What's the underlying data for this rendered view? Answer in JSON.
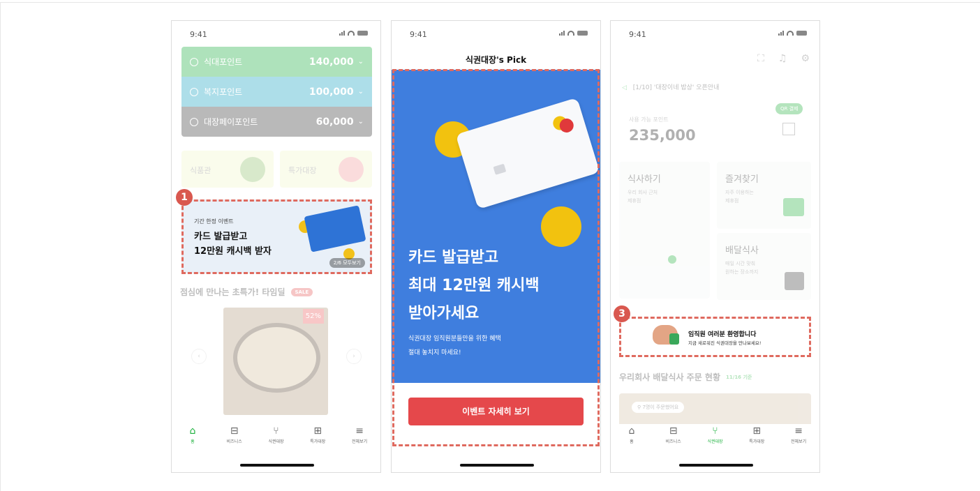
{
  "status": {
    "time": "9:41"
  },
  "phone1": {
    "points": [
      {
        "label": "식대포인트",
        "amount": "140,000",
        "color": "#2db44e"
      },
      {
        "label": "복지포인트",
        "amount": "100,000",
        "color": "#2aa9c6"
      },
      {
        "label": "대장페이포인트",
        "amount": "60,000",
        "color": "#4a4a4a"
      }
    ],
    "shops": [
      "식품관",
      "특가대장"
    ],
    "banner": {
      "small": "기간 한정 이벤트",
      "line1": "카드 발급받고",
      "line2": "12만원 캐시백 받자",
      "pager": "2/6 모두보기"
    },
    "section_title": "점심에 만나는 초특가! 타임딜",
    "sale_badge": "SALE",
    "discount": "52%",
    "tabs": [
      {
        "label": "홈",
        "icon": "home-icon",
        "glyph": "⌂"
      },
      {
        "label": "비즈니스",
        "icon": "briefcase-icon",
        "glyph": "⊟"
      },
      {
        "label": "식권대장",
        "icon": "fork-knife-icon",
        "glyph": "⑂"
      },
      {
        "label": "특가대장",
        "icon": "store-icon",
        "glyph": "⊞"
      },
      {
        "label": "전체보기",
        "icon": "menu-icon",
        "glyph": "≡"
      }
    ],
    "marker": "1"
  },
  "phone2": {
    "header": "식권대장's Pick",
    "title_line1": "카드 발급받고",
    "title_line2": "최대 12만원 캐시백",
    "title_line3": "받아가세요",
    "sub_line1": "식권대장 임직원분들만을 위한 혜택",
    "sub_line2": "절대 놓치지 마세요!",
    "button": "이벤트 자세히 보기"
  },
  "phone3": {
    "notice": "[1/10] '대장이네 밥상' 오픈안내",
    "points_label": "사용 가능 포인트",
    "points_value": "235,000",
    "pill": "QR 결제",
    "tiles": [
      {
        "title": "식사하기",
        "sub1": "우리 회사 근처",
        "sub2": "제휴점"
      },
      {
        "title": "즐겨찾기",
        "sub1": "자주 이용하는",
        "sub2": "제휴점"
      },
      {
        "title": "배달식사",
        "sub1": "매일 시간 맞춰",
        "sub2": "원하는 장소까지"
      }
    ],
    "welcome_title": "임직원 여러분 환영합니다",
    "welcome_sub": "지금 새로워진 식권대장을 만나보세요!",
    "delivery_title": "우리회사 배달식사 주문 현황",
    "delivery_tag": "11/16 기준",
    "order_chip": "7명이 주문했어요",
    "tabs": [
      {
        "label": "홈",
        "glyph": "⌂"
      },
      {
        "label": "비즈니스",
        "glyph": "⊟"
      },
      {
        "label": "식권대장",
        "glyph": "⑂"
      },
      {
        "label": "특가대장",
        "glyph": "⊞"
      },
      {
        "label": "전체보기",
        "glyph": "≡"
      }
    ],
    "marker": "3"
  },
  "colors": {
    "accent_red": "#df6a5f",
    "brand_green": "#1ab03b",
    "banner_blue": "#3f7ede"
  }
}
